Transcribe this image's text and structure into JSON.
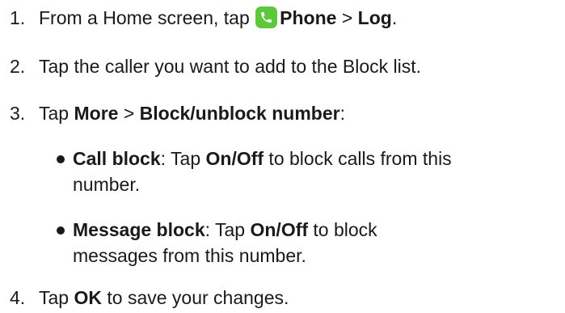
{
  "steps": [
    {
      "num": "1.",
      "pre": "From a Home screen, tap ",
      "bold1": "Phone",
      "sep": " > ",
      "bold2": "Log",
      "post": "."
    },
    {
      "num": "2.",
      "text": "Tap the caller you want to add to the Block list."
    },
    {
      "num": "3.",
      "pre": "Tap ",
      "bold1": "More",
      "sep": " > ",
      "bold2": "Block/unblock number",
      "post": ":"
    },
    {
      "num": "4.",
      "pre": "Tap ",
      "bold1": "OK",
      "post": " to save your changes."
    }
  ],
  "bullets": [
    {
      "title": "Call block",
      "mid": ": Tap ",
      "action": "On/Off",
      "line1_rest": " to block calls from this",
      "line2": "number."
    },
    {
      "title": "Message block",
      "mid": ": Tap ",
      "action": "On/Off",
      "line1_rest": " to block",
      "line2": "messages from this number."
    }
  ],
  "icons": {
    "phone_icon": "phone-handset",
    "phone_icon_color": "#5cc83a"
  }
}
